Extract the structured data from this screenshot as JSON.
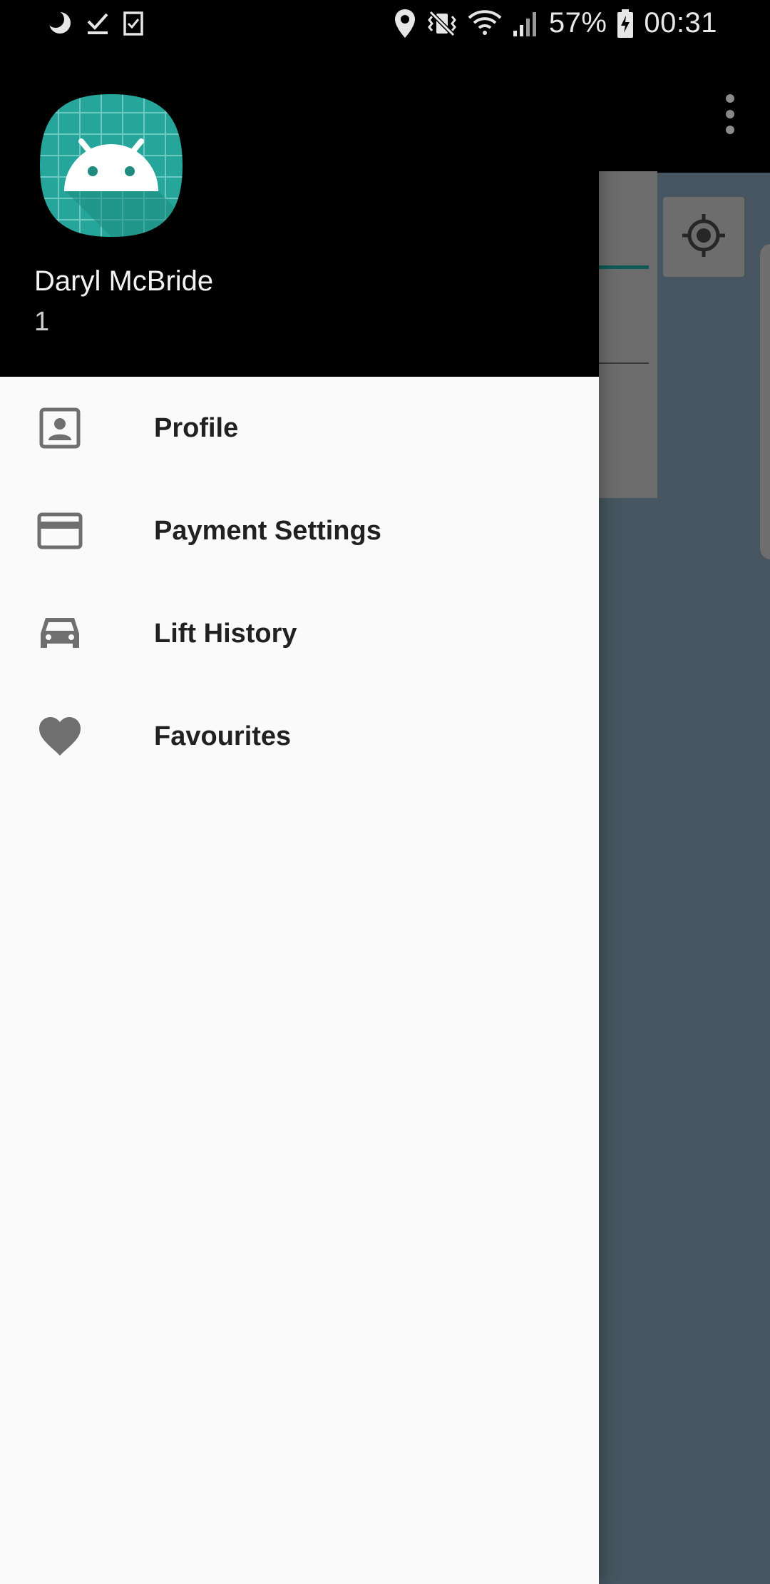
{
  "status_bar": {
    "battery": "57%",
    "time": "00:31",
    "icons_left": [
      "moon-icon",
      "check-download-icon",
      "clipboard-check-icon"
    ],
    "icons_right": [
      "location-pin-icon",
      "vibrate-mute-icon",
      "wifi-icon",
      "signal-icon",
      "battery-icon"
    ]
  },
  "drawer": {
    "header": {
      "user_name": "Daryl McBride",
      "user_sub": "1",
      "avatar_icon": "android-app-icon",
      "background": "#000000"
    },
    "items": [
      {
        "label": "Profile",
        "icon": "profile-icon"
      },
      {
        "label": "Payment Settings",
        "icon": "credit-card-icon"
      },
      {
        "label": "Lift History",
        "icon": "car-icon"
      },
      {
        "label": "Favourites",
        "icon": "heart-icon"
      }
    ]
  },
  "app": {
    "overflow_icon": "more-vert-icon",
    "locate_icon": "my-location-icon",
    "colors": {
      "accent": "#0e5b58",
      "map_bg": "#46555f",
      "icon_gray": "#6f6f6f"
    }
  }
}
